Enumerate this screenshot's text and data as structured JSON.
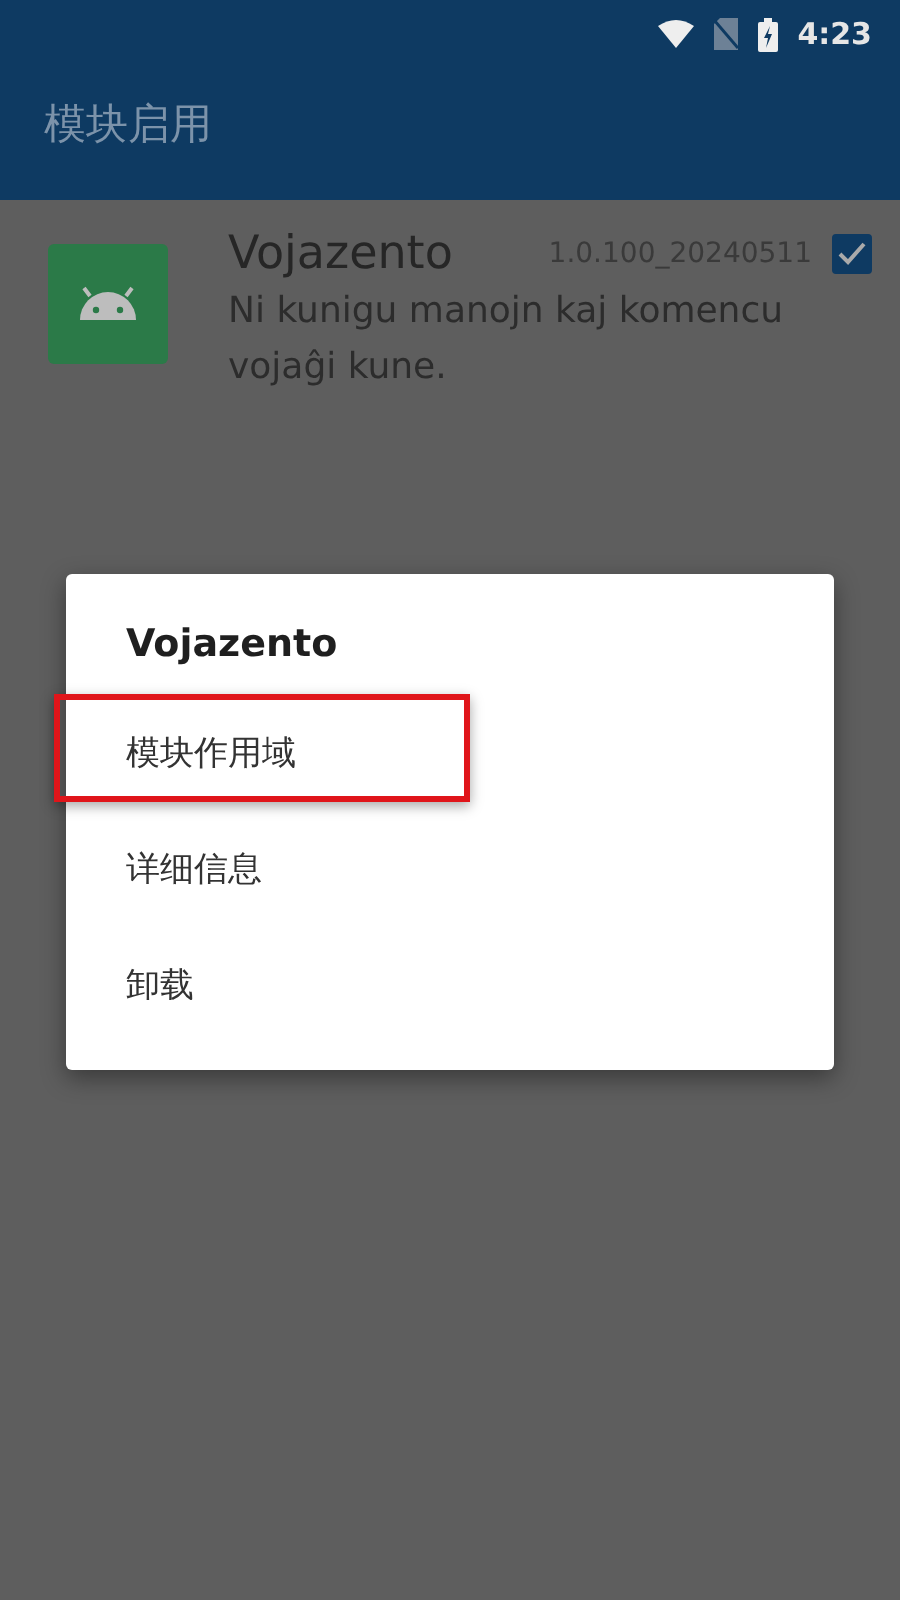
{
  "status_bar": {
    "time": "4:23"
  },
  "app_bar": {
    "title": "模块启用"
  },
  "modules": [
    {
      "name": "Vojazento",
      "version": "1.0.100_20240511",
      "description": "Ni kunigu manojn kaj komencu vojaĝi kune.",
      "checked": true
    }
  ],
  "dialog": {
    "title": "Vojazento",
    "items": [
      {
        "label": "模块作用域",
        "highlighted": true
      },
      {
        "label": "详细信息",
        "highlighted": false
      },
      {
        "label": "卸载",
        "highlighted": false
      }
    ]
  }
}
